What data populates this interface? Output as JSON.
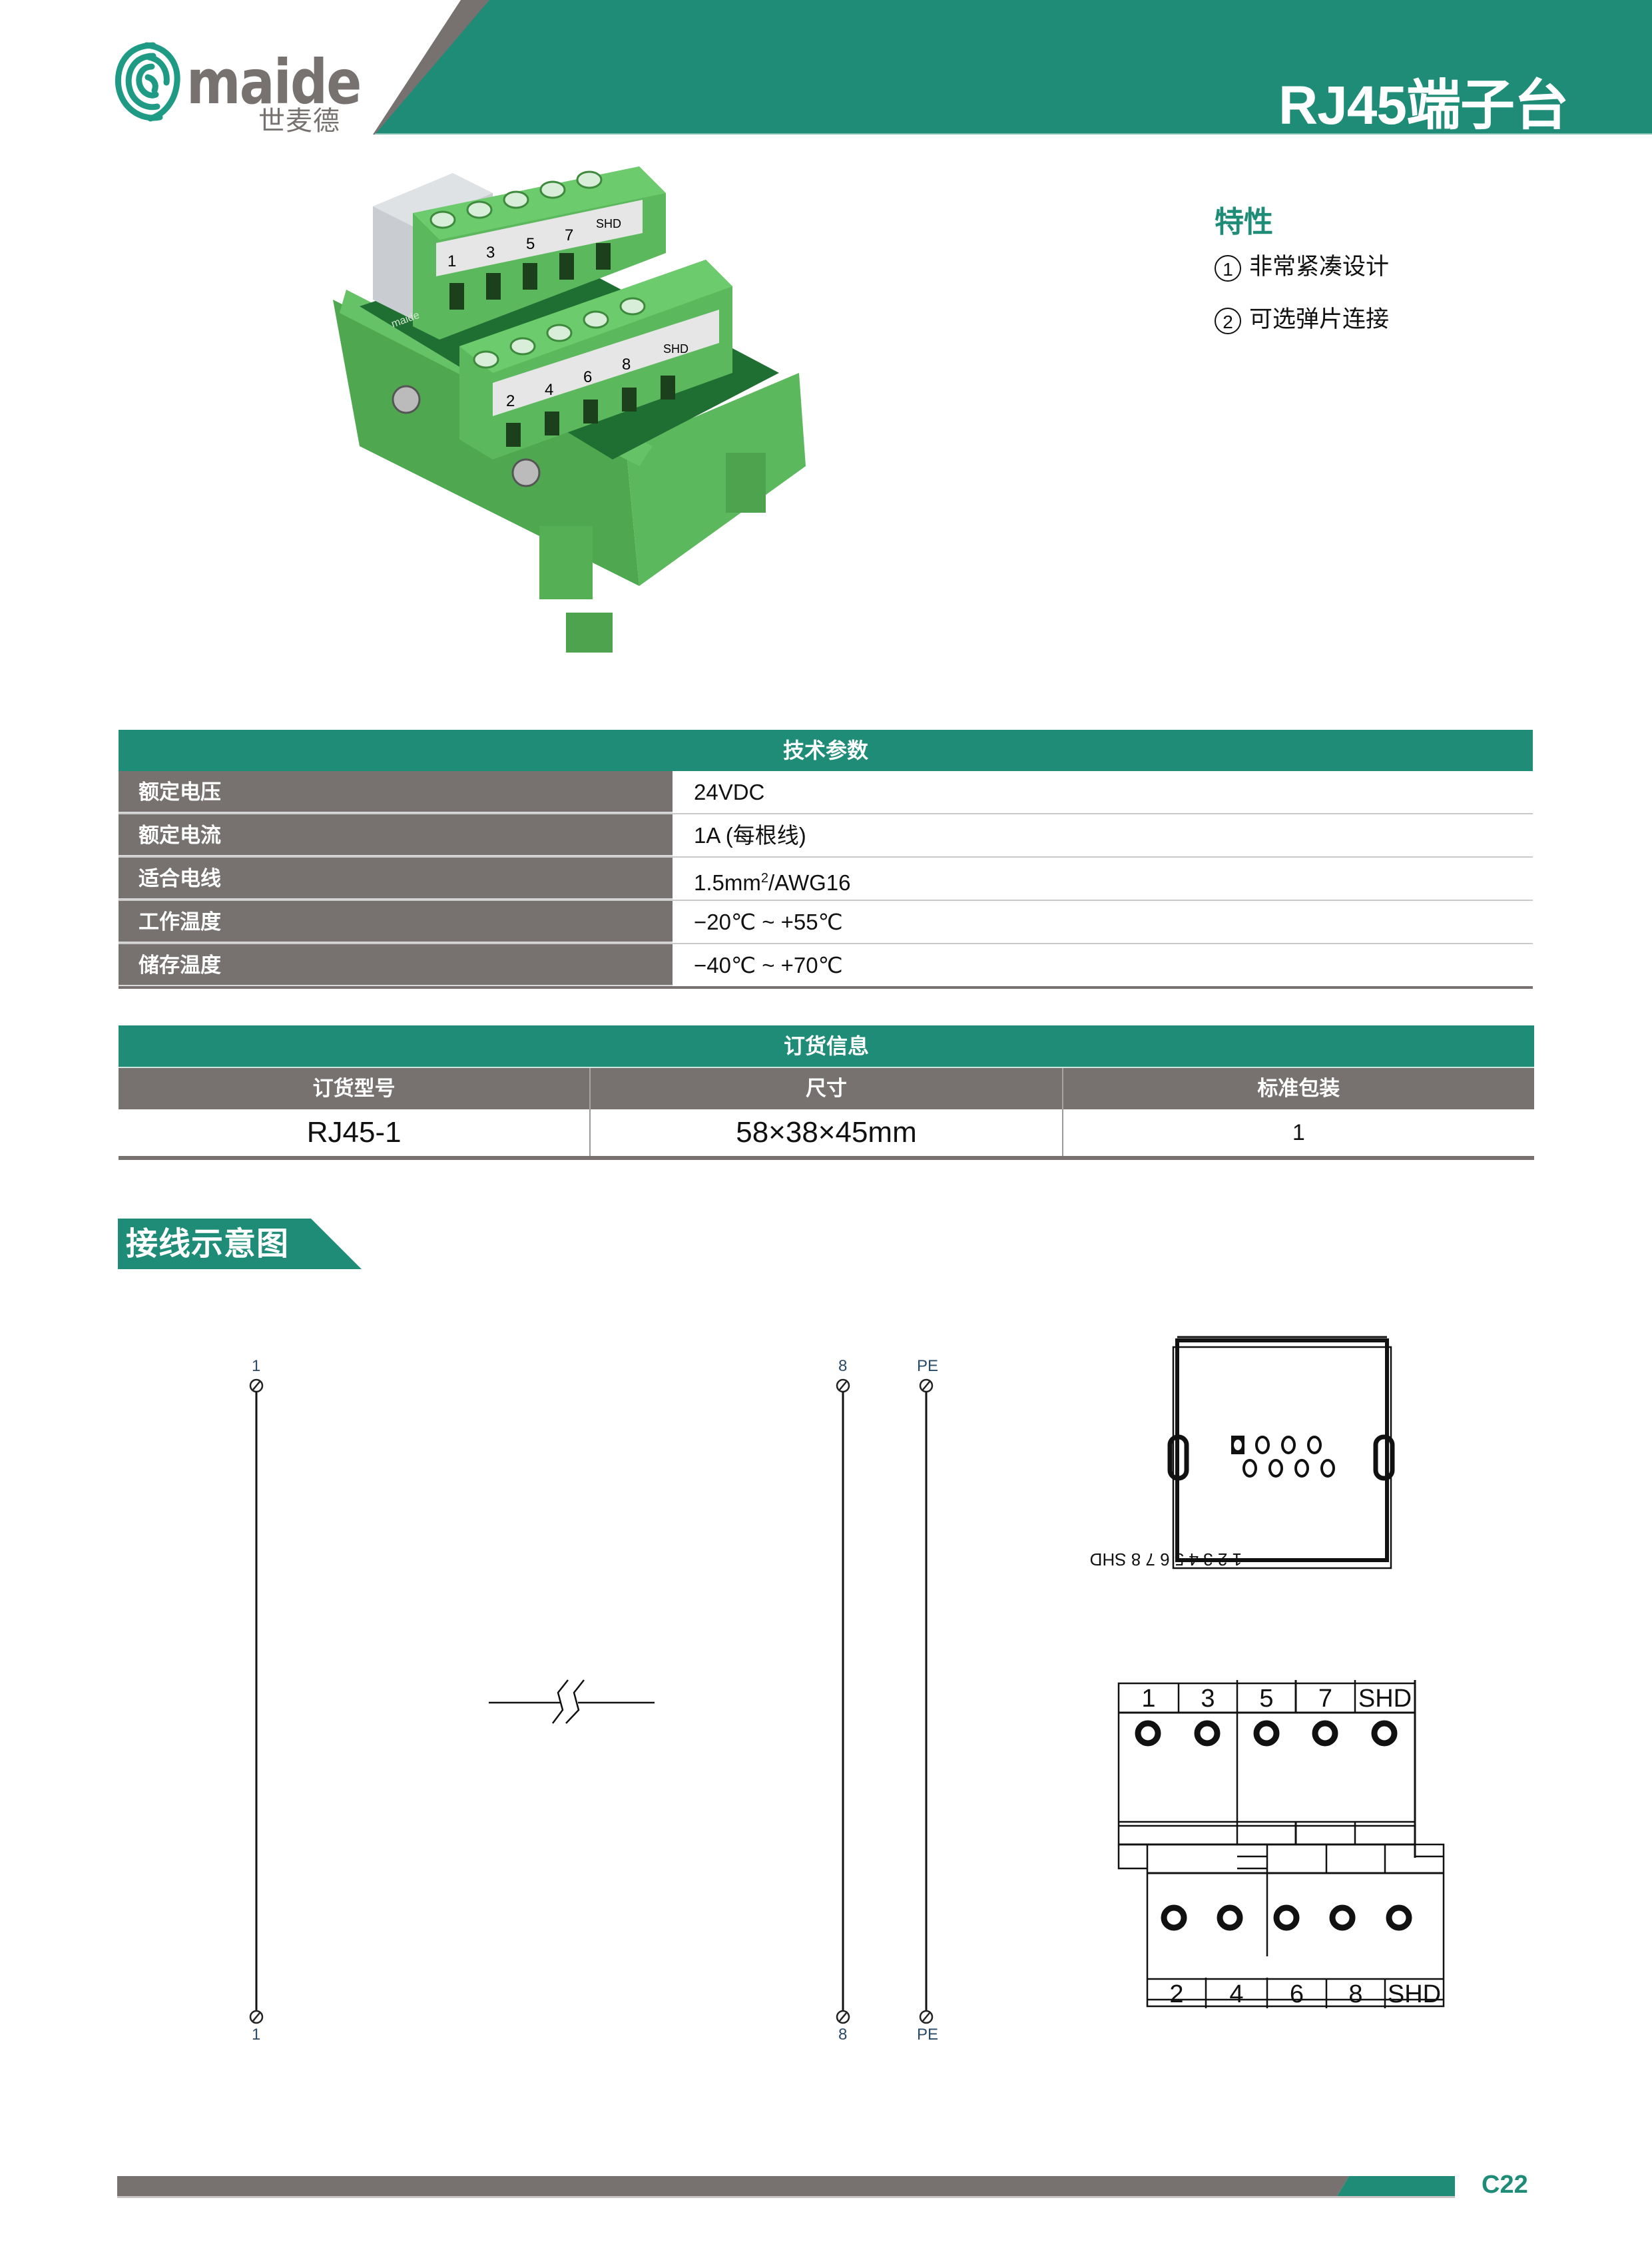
{
  "header": {
    "brand_name": "maide",
    "brand_name_cn": "世麦德",
    "title": "RJ45端子台"
  },
  "colors": {
    "brand_green": "#1f8c78",
    "brand_gray": "#777170",
    "product_green": "#5cb85c"
  },
  "product_photo": {
    "alt": "RJ45 terminal block module on DIN rail base",
    "top_labels": [
      "1",
      "3",
      "5",
      "7",
      "SHD"
    ],
    "bottom_labels": [
      "2",
      "4",
      "6",
      "8",
      "SHD"
    ],
    "pcb_brand": "maide"
  },
  "features": {
    "title": "特性",
    "items": [
      {
        "num": "1",
        "text": "非常紧凑设计"
      },
      {
        "num": "2",
        "text": "可选弹片连接"
      }
    ]
  },
  "tech_params": {
    "title": "技术参数",
    "rows": [
      {
        "label": "额定电压",
        "value": "24VDC"
      },
      {
        "label": "额定电流",
        "value": "1A (每根线)"
      },
      {
        "label": "适合电线",
        "value_main": "1.5mm",
        "value_sup": "2",
        "value_rest": "/AWG16"
      },
      {
        "label": "工作温度",
        "value": "−20℃ ~ +55℃"
      },
      {
        "label": "储存温度",
        "value": "−40℃ ~ +70℃"
      }
    ]
  },
  "order_info": {
    "title": "订货信息",
    "columns": [
      "订货型号",
      "尺寸",
      "标准包装"
    ],
    "rows": [
      [
        "RJ45-1",
        "58×38×45mm",
        "1"
      ]
    ]
  },
  "wiring": {
    "section_title": "接线示意图",
    "terminals": [
      {
        "top_label": "1",
        "bottom_label": "1"
      },
      {
        "top_label": "8",
        "bottom_label": "8"
      },
      {
        "top_label": "PE",
        "bottom_label": "PE"
      }
    ],
    "rj45_pin_labels": "1 2 3 4 5 6 7 8 SHD",
    "top_row_labels": [
      "1",
      "3",
      "5",
      "7",
      "SHD"
    ],
    "bottom_row_labels": [
      "2",
      "4",
      "6",
      "8",
      "SHD"
    ]
  },
  "footer": {
    "page_number": "C22"
  }
}
